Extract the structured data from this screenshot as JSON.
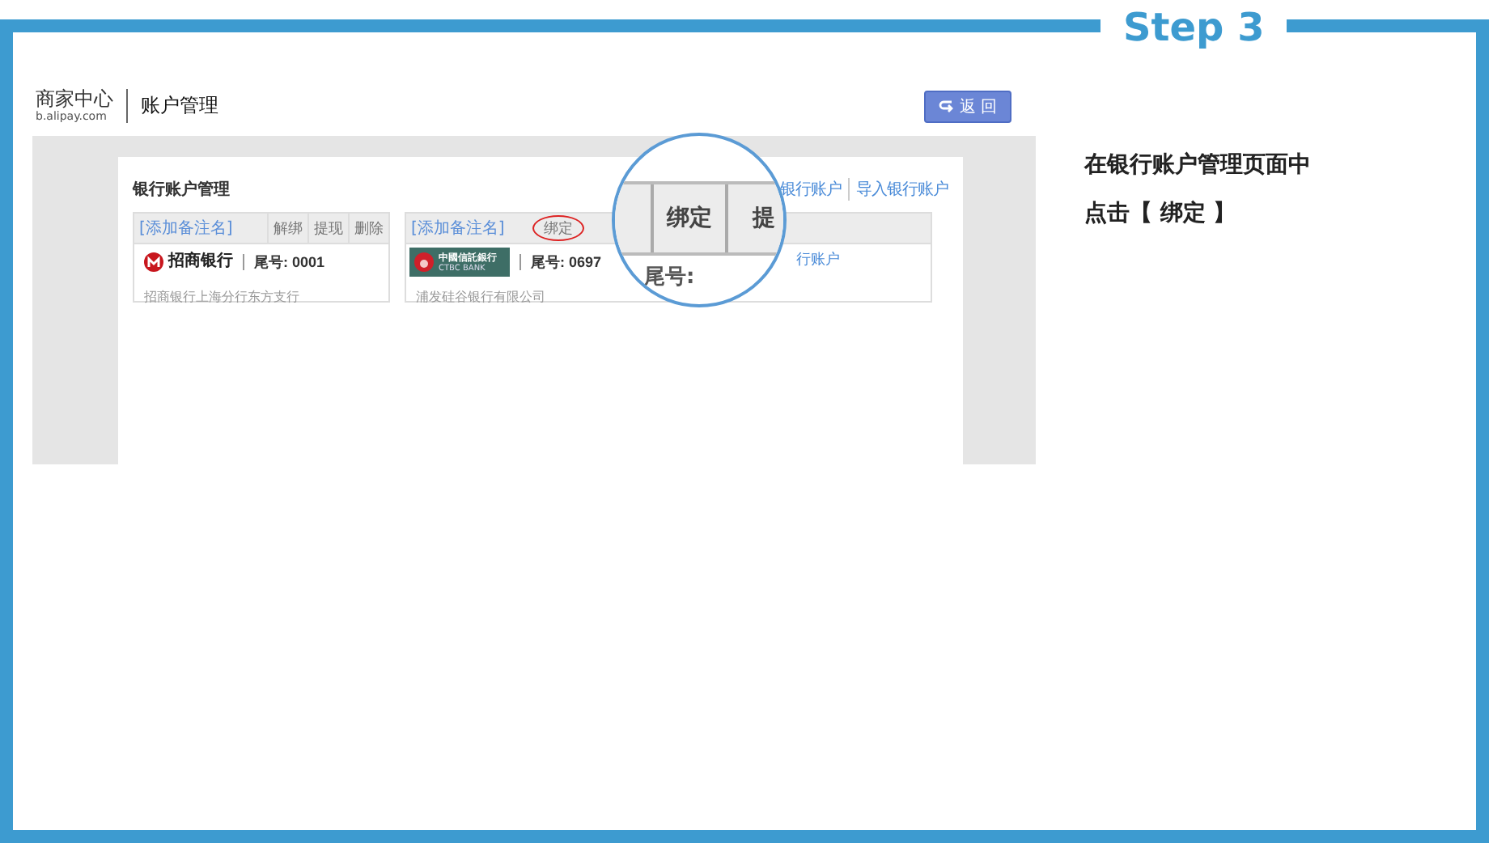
{
  "step": {
    "label": "Step 3"
  },
  "header": {
    "logo_title": "商家中心",
    "logo_domain": "b.alipay.com",
    "page_title": "账户管理",
    "back_button": "返 回"
  },
  "panel": {
    "title": "银行账户管理",
    "links": [
      "银行账户",
      "导入银行账户"
    ]
  },
  "cards": [
    {
      "note_link": "[添加备注名]",
      "actions": [
        {
          "label": "解绑",
          "highlighted": false
        },
        {
          "label": "提现",
          "highlighted": false
        },
        {
          "label": "删除",
          "highlighted": false
        }
      ],
      "bank_logo": {
        "kind": "cmb",
        "text": "招商银行"
      },
      "tail": "尾号: 0001",
      "branch": "招商银行上海分行东方支行"
    },
    {
      "note_link": "[添加备注名]",
      "actions": [
        {
          "label": "绑定",
          "highlighted": true
        }
      ],
      "bank_logo": {
        "kind": "ctbc",
        "text": "中國信託銀行",
        "subtext": "CTBC BANK"
      },
      "tail": "尾号: 0697",
      "branch": "浦发硅谷银行有限公司",
      "side_link": "行账户"
    }
  ],
  "magnifier": {
    "actions": [
      "绑定",
      "提"
    ],
    "tail_label": "尾号:"
  },
  "instruction": {
    "lines": [
      "在银行账户管理页面中",
      "点击【 绑定 】"
    ]
  }
}
